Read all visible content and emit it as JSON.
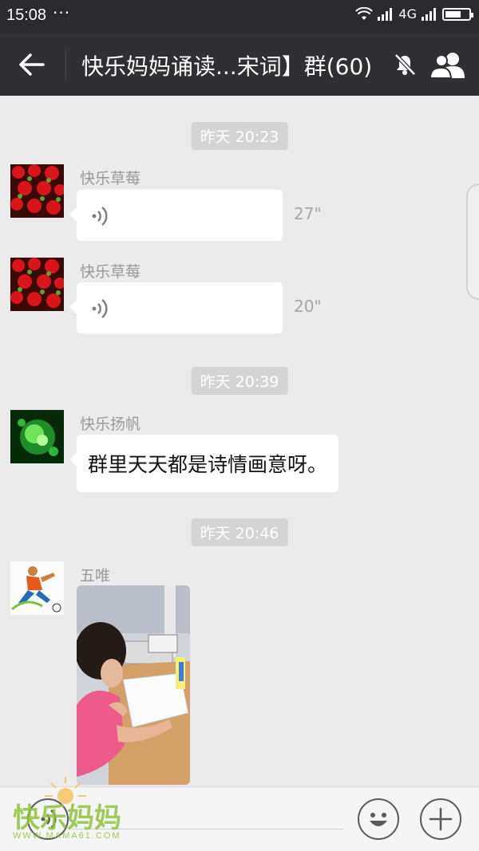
{
  "status_bar": {
    "time": "15:08",
    "more": "···",
    "network": "4G"
  },
  "nav": {
    "title": "快乐妈妈诵读...宋词】群(60)"
  },
  "colors": {
    "nav_bg": "#2f2f34",
    "chat_bg": "#ebebeb",
    "bubble": "#ffffff",
    "watermark": "#8fc33a"
  },
  "messages": [
    {
      "time_chip": "昨天 20:23",
      "sender": "快乐草莓",
      "kind": "voice",
      "duration": "27\""
    },
    {
      "sender": "快乐草莓",
      "kind": "voice",
      "duration": "20\""
    },
    {
      "time_chip": "昨天 20:39",
      "sender": "快乐扬帆",
      "kind": "text",
      "text": "群里天天都是诗情画意呀。"
    },
    {
      "time_chip": "昨天 20:46",
      "sender": "五唯",
      "kind": "image"
    }
  ],
  "watermark": {
    "main": "快乐妈妈",
    "sub": "WWW.MAMA61.COM"
  },
  "icons": {
    "back": "back-arrow-icon",
    "mute": "mute-bell-icon",
    "group": "group-members-icon",
    "voice": "voice-wave-icon",
    "emoji": "emoji-icon",
    "plus": "plus-icon"
  }
}
